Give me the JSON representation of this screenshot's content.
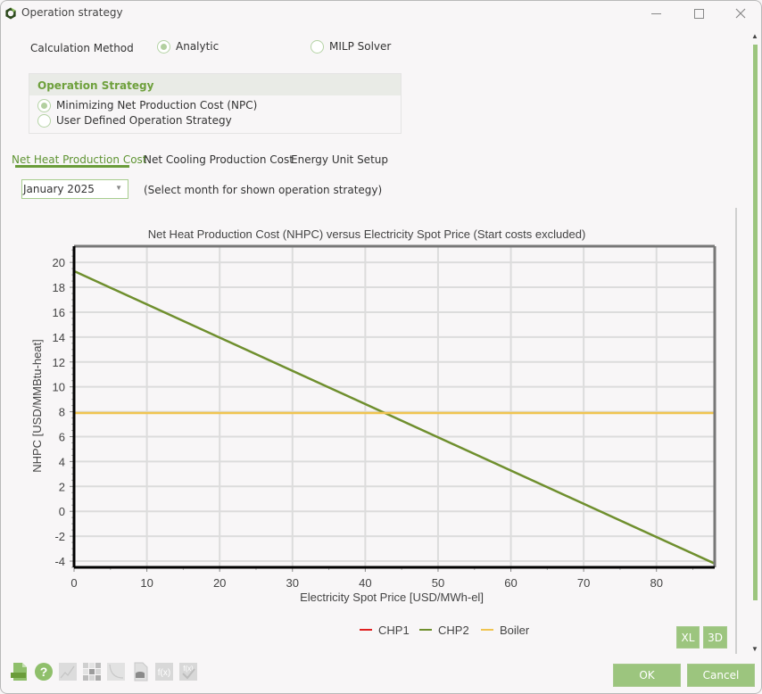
{
  "window": {
    "title": "Operation strategy",
    "controls": {
      "minimize": "minimize-icon",
      "maximize": "maximize-icon",
      "close": "close-icon"
    }
  },
  "calculation_method": {
    "label": "Calculation Method",
    "options": [
      {
        "label": "Analytic",
        "selected": true
      },
      {
        "label": "MILP Solver",
        "selected": false
      }
    ]
  },
  "operation_strategy": {
    "title": "Operation Strategy",
    "options": [
      {
        "label": "Minimizing Net Production Cost (NPC)",
        "selected": true
      },
      {
        "label": "User Defined Operation Strategy",
        "selected": false
      }
    ]
  },
  "tabs": [
    {
      "label": "Net Heat Production Cost",
      "active": true
    },
    {
      "label": "Net Cooling Production Cost",
      "active": false
    },
    {
      "label": "Energy Unit Setup",
      "active": false
    }
  ],
  "month_select": {
    "value": "January 2025",
    "hint": "(Select month for shown operation strategy)"
  },
  "chart_buttons": {
    "xl": "XL",
    "three_d": "3D"
  },
  "toolbar_icons": [
    "export-jpg-icon",
    "help-icon",
    "line-chart-icon",
    "heatmap-icon",
    "curve-icon",
    "database-report-icon",
    "function-icon",
    "function-check-icon"
  ],
  "footer": {
    "ok": "OK",
    "cancel": "Cancel"
  },
  "colors": {
    "accent": "#9cc57e",
    "accent_dark": "#6a9c3a",
    "chp1": "#e02020",
    "chp2": "#6f8f2e",
    "boiler": "#f0c450"
  },
  "chart_data": {
    "type": "line",
    "title": "Net Heat Production Cost (NHPC) versus Electricity Spot Price (Start costs excluded)",
    "xlabel": "Electricity Spot Price [USD/MWh-el]",
    "ylabel": "NHPC [USD/MMBtu-heat]",
    "xlim": [
      0,
      88
    ],
    "ylim": [
      -4.5,
      21.3
    ],
    "xticks": [
      0,
      10,
      20,
      30,
      40,
      50,
      60,
      70,
      80
    ],
    "yticks": [
      -4,
      -2,
      0,
      2,
      4,
      6,
      8,
      10,
      12,
      14,
      16,
      18,
      20
    ],
    "grid": true,
    "legend_position": "bottom-center",
    "series": [
      {
        "name": "CHP1",
        "color": "#e02020",
        "x": [],
        "y": []
      },
      {
        "name": "CHP2",
        "color": "#6f8f2e",
        "x": [
          0,
          88
        ],
        "y": [
          19.3,
          -4.2
        ]
      },
      {
        "name": "Boiler",
        "color": "#f0c450",
        "x": [
          0,
          88
        ],
        "y": [
          7.9,
          7.9
        ]
      }
    ]
  }
}
